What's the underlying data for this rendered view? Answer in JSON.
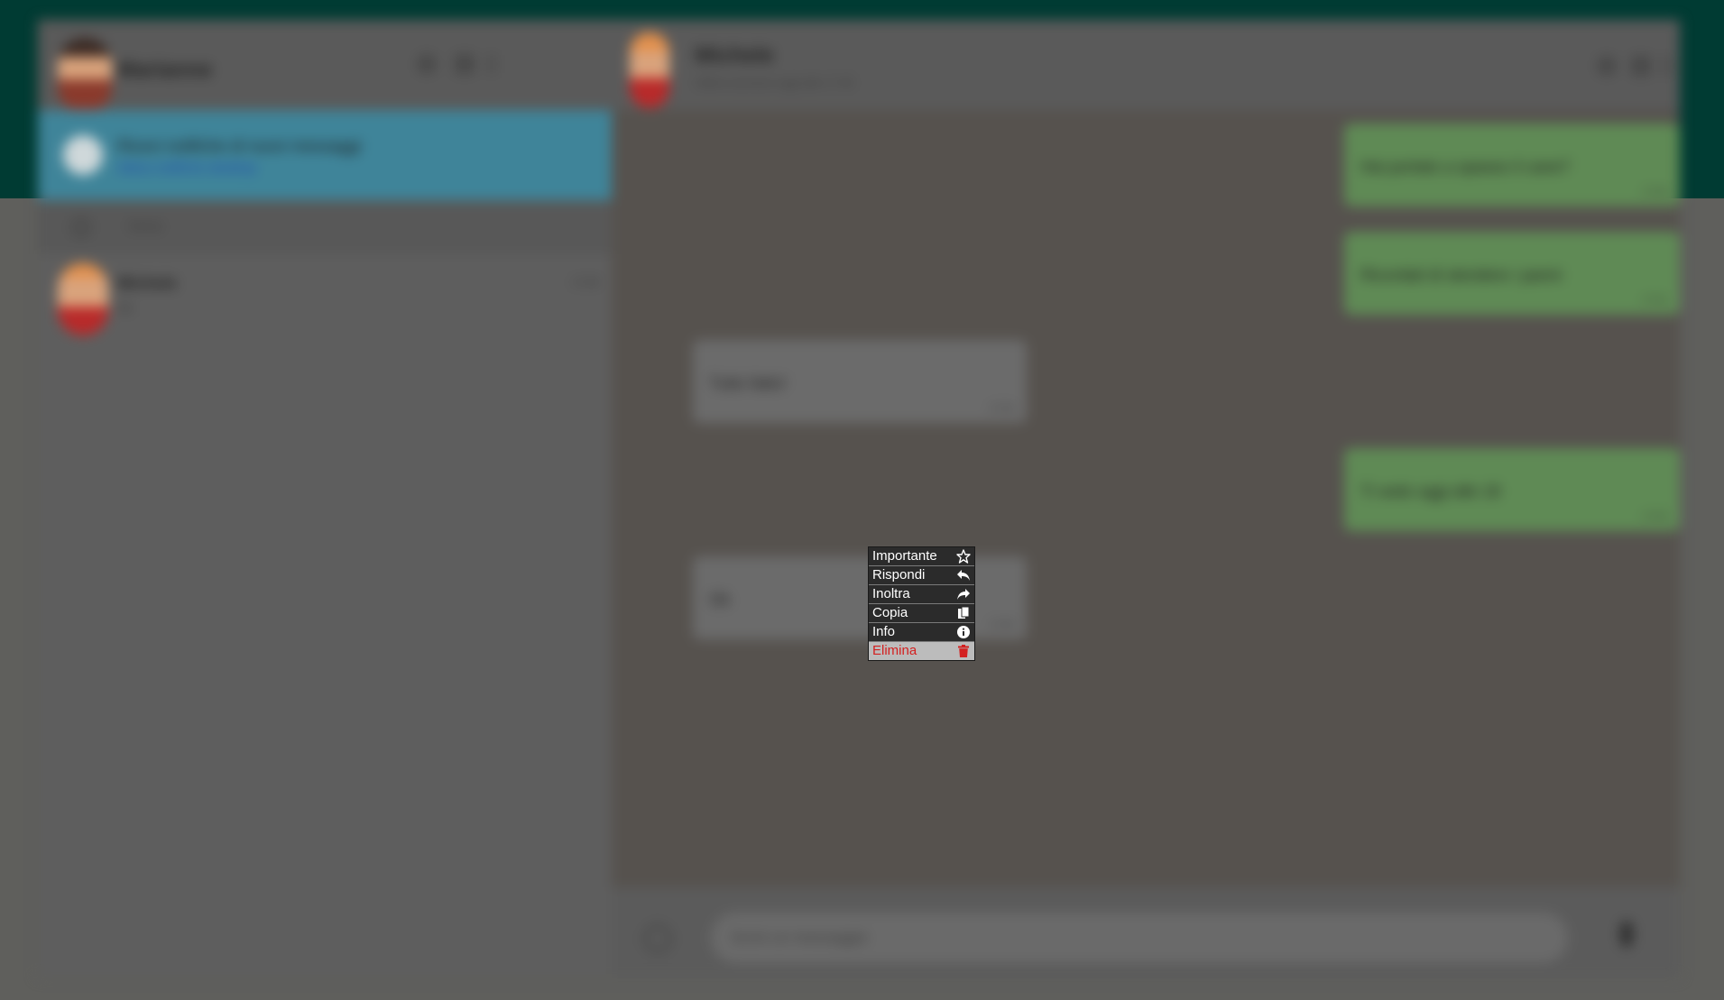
{
  "sidebar": {
    "user_name": "Marianne",
    "notification": {
      "title": "Ricevi notifiche di nuovi messaggi",
      "link": "Attiva notifiche desktop"
    },
    "search_placeholder": "Cerca",
    "chats": [
      {
        "name": "Michele",
        "preview": "Ok",
        "time": "17:45"
      }
    ]
  },
  "chat": {
    "contact_name": "Michele",
    "status": "Ultimo accesso oggi alle 17:45",
    "messages": [
      {
        "direction": "sent",
        "text": "Hai portato a spasso il cane?",
        "time": "17:40"
      },
      {
        "direction": "sent",
        "text": "Ricordati di stendere i panni",
        "time": "17:41"
      },
      {
        "direction": "received",
        "text": "Tutto fatto!",
        "time": "17:43"
      },
      {
        "direction": "sent",
        "text": "Ti vedo oggi alle 18",
        "time": "17:44"
      },
      {
        "direction": "received",
        "text": "Ok",
        "time": "17:45"
      }
    ],
    "composer_placeholder": "Scrivi un messaggio"
  },
  "context_menu": {
    "items": [
      {
        "label": "Importante",
        "icon": "star-icon"
      },
      {
        "label": "Rispondi",
        "icon": "reply-icon"
      },
      {
        "label": "Inoltra",
        "icon": "forward-icon"
      },
      {
        "label": "Copia",
        "icon": "copy-icon"
      },
      {
        "label": "Info",
        "icon": "info-icon"
      },
      {
        "label": "Elimina",
        "icon": "trash-icon",
        "danger": true
      }
    ]
  },
  "colors": {
    "header_bg": "#003b33",
    "sent_bubble": "#5f8a55",
    "danger": "#d32020"
  }
}
